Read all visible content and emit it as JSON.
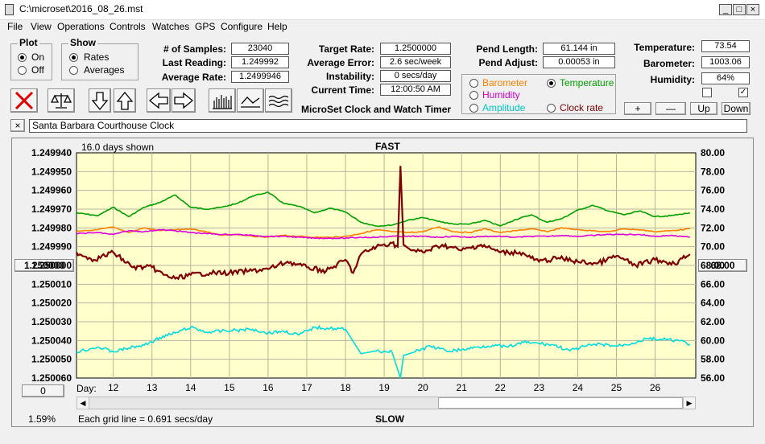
{
  "window": {
    "title": "C:\\microset\\2016_08_26.mst"
  },
  "window_controls": {
    "minimize": "_",
    "maximize": "□",
    "close": "×"
  },
  "menu": [
    "File",
    "View",
    "Operations",
    "Controls",
    "Watches",
    "GPS",
    "Configure",
    "Help"
  ],
  "plot_group": {
    "title": "Plot",
    "on_label": "On",
    "off_label": "Off",
    "selected": "On"
  },
  "show_group": {
    "title": "Show",
    "rates_label": "Rates",
    "averages_label": "Averages",
    "selected": "Rates"
  },
  "stats": {
    "samples_label": "# of Samples:",
    "samples_value": "23040",
    "last_reading_label": "Last Reading:",
    "last_reading_value": "1.249992",
    "average_rate_label": "Average Rate:",
    "average_rate_value": "1.2499946",
    "target_rate_label": "Target Rate:",
    "target_rate_value": "1.2500000",
    "average_error_label": "Average Error:",
    "average_error_value": "2.6 sec/week",
    "instability_label": "Instability:",
    "instability_value": "0 secs/day",
    "current_time_label": "Current Time:",
    "current_time_value": "12:00:50 AM",
    "pend_length_label": "Pend Length:",
    "pend_length_value": "61.144 in",
    "pend_adjust_label": "Pend Adjust:",
    "pend_adjust_value": "0.00053 in",
    "temperature_label": "Temperature:",
    "temperature_value": "73.54",
    "barometer_label": "Barometer:",
    "barometer_value": "1003.06",
    "humidity_label": "Humidity:",
    "humidity_value": "64%"
  },
  "app_caption": "MicroSet Clock and Watch Timer",
  "sensor_select": {
    "barometer": "Barometer",
    "temperature": "Temperature",
    "humidity": "Humidity",
    "amplitude": "Amplitude",
    "clock_rate": "Clock rate",
    "selected": "Temperature",
    "colors": {
      "barometer": "#ff8000",
      "temperature": "#00a000",
      "humidity": "#cc00cc",
      "amplitude": "#00c8c8",
      "clock_rate": "#800000"
    }
  },
  "adjust_buttons": {
    "plus": "+",
    "minus": "—",
    "up": "Up",
    "down": "Down"
  },
  "checkboxes": {
    "left": "",
    "right": "✓"
  },
  "clock_name": {
    "close": "×",
    "value": "Santa Barbara Courthouse Clock"
  },
  "chart_header": {
    "days_shown": "16.0 days shown",
    "top_label": "FAST",
    "bottom_label": "SLOW",
    "left_center_button": "1.250000",
    "right_center_button": "68.00",
    "scroll_button": "0",
    "day_prefix": "Day:",
    "percent": "1.59%",
    "grid_note": "Each grid line = 0.691 secs/day"
  },
  "chart_data": {
    "type": "line",
    "x_label": "Day:",
    "x_ticks": [
      "12",
      "13",
      "14",
      "15",
      "16",
      "17",
      "18",
      "19",
      "20",
      "21",
      "22",
      "23",
      "24",
      "25",
      "26"
    ],
    "y_left_ticks": [
      "1.249940",
      "1.249950",
      "1.249960",
      "1.249970",
      "1.249980",
      "1.249990",
      "1.250000",
      "1.250010",
      "1.250020",
      "1.250030",
      "1.250040",
      "1.250050",
      "1.250060"
    ],
    "y_right_ticks": [
      "80.00",
      "78.00",
      "76.00",
      "74.00",
      "72.00",
      "70.00",
      "68.00",
      "66.00",
      "64.00",
      "62.00",
      "60.00",
      "58.00",
      "56.00"
    ],
    "ylim_left": [
      1.25006,
      1.24994
    ],
    "ylim_right": [
      56.0,
      80.0
    ],
    "x_range": [
      11.05,
      27.05
    ],
    "grid": true,
    "series": [
      {
        "color": "#00a000",
        "axis": "right",
        "x": [
          11.05,
          11.6,
          12.0,
          12.4,
          12.8,
          13.2,
          13.6,
          14.0,
          14.4,
          14.8,
          15.2,
          15.6,
          16.0,
          16.4,
          16.8,
          17.2,
          17.6,
          18.0,
          18.4,
          18.8,
          19.2,
          19.6,
          20.0,
          20.4,
          20.8,
          21.2,
          21.6,
          22.0,
          22.4,
          22.8,
          23.2,
          23.6,
          24.0,
          24.4,
          24.8,
          25.2,
          25.6,
          26.0,
          26.4,
          26.9
        ],
        "y": [
          73.6,
          73.3,
          74.2,
          73.2,
          74.2,
          74.7,
          75.5,
          74.2,
          74.0,
          74.2,
          74.6,
          75.4,
          75.8,
          74.6,
          74.3,
          73.6,
          74.1,
          73.7,
          72.6,
          72.2,
          72.3,
          72.8,
          73.1,
          72.7,
          72.4,
          72.4,
          72.8,
          72.2,
          72.9,
          73.4,
          72.6,
          73.0,
          73.9,
          74.4,
          73.8,
          73.4,
          73.8,
          73.2,
          73.3,
          73.6
        ]
      },
      {
        "color": "#ff8000",
        "axis": "right",
        "x": [
          11.05,
          11.6,
          12.0,
          12.4,
          12.8,
          13.2,
          13.6,
          14.0,
          14.4,
          14.8,
          15.2,
          15.6,
          16.0,
          16.4,
          16.8,
          17.2,
          17.6,
          18.0,
          18.4,
          18.8,
          19.2,
          19.6,
          20.0,
          20.4,
          20.8,
          21.2,
          21.6,
          22.0,
          22.4,
          22.8,
          23.2,
          23.6,
          24.0,
          24.4,
          24.8,
          25.2,
          25.6,
          26.0,
          26.4,
          26.9
        ],
        "y": [
          71.6,
          71.8,
          72.1,
          71.5,
          72.0,
          71.7,
          71.8,
          71.9,
          71.6,
          71.2,
          71.3,
          71.1,
          71.0,
          71.2,
          71.1,
          71.0,
          71.0,
          71.1,
          71.4,
          71.8,
          71.6,
          71.5,
          71.6,
          72.1,
          71.6,
          71.5,
          71.9,
          71.5,
          71.7,
          71.9,
          71.6,
          72.0,
          71.8,
          71.7,
          71.6,
          71.9,
          71.8,
          71.6,
          71.7,
          71.9
        ]
      },
      {
        "color": "#dd00dd",
        "axis": "right",
        "x": [
          11.05,
          11.6,
          12.0,
          12.4,
          12.8,
          13.2,
          13.6,
          14.0,
          14.4,
          14.8,
          15.2,
          15.6,
          16.0,
          16.4,
          16.8,
          17.2,
          17.6,
          18.0,
          18.4,
          18.8,
          19.2,
          19.6,
          20.0,
          20.4,
          20.8,
          21.2,
          21.6,
          22.0,
          22.4,
          22.8,
          23.2,
          23.6,
          24.0,
          24.4,
          24.8,
          25.2,
          25.6,
          26.0,
          26.4,
          26.9
        ],
        "y": [
          71.4,
          71.5,
          71.3,
          71.7,
          71.6,
          71.8,
          71.7,
          71.5,
          71.4,
          71.3,
          71.3,
          71.2,
          71.1,
          71.1,
          71.0,
          70.9,
          70.9,
          70.9,
          71.0,
          71.0,
          71.1,
          71.1,
          71.1,
          71.0,
          71.1,
          71.0,
          71.1,
          71.1,
          71.0,
          71.1,
          71.1,
          71.2,
          71.1,
          71.2,
          71.3,
          71.3,
          71.3,
          71.1,
          71.2,
          71.0
        ]
      },
      {
        "color": "#800000",
        "axis": "left",
        "x": [
          11.05,
          11.5,
          12.0,
          12.5,
          13.0,
          13.3,
          13.6,
          14.0,
          14.5,
          15.0,
          15.5,
          16.0,
          16.5,
          17.0,
          17.5,
          18.0,
          18.2,
          18.4,
          18.8,
          19.2,
          19.35,
          19.42,
          19.5,
          19.7,
          20.0,
          20.5,
          21.0,
          21.5,
          22.0,
          22.5,
          23.0,
          23.5,
          24.0,
          24.5,
          25.0,
          25.5,
          26.0,
          26.5,
          26.9
        ],
        "y": [
          1.249993,
          1.249997,
          1.249993,
          1.250001,
          1.250001,
          1.250005,
          1.250007,
          1.250005,
          1.250004,
          1.250004,
          1.250003,
          1.250002,
          1.249998,
          1.250001,
          1.250003,
          1.249997,
          1.250004,
          1.249994,
          1.24999,
          1.249988,
          1.24999,
          1.249947,
          1.249989,
          1.249992,
          1.249993,
          1.249989,
          1.249992,
          1.249989,
          1.249993,
          1.249993,
          1.249998,
          1.249996,
          1.249998,
          1.249999,
          1.249995,
          1.25,
          1.249997,
          1.249999,
          1.249994
        ]
      },
      {
        "color": "#00dddd",
        "axis": "right",
        "x": [
          11.05,
          11.6,
          12.0,
          12.4,
          12.8,
          13.2,
          13.6,
          14.0,
          14.4,
          14.8,
          15.2,
          15.6,
          16.0,
          16.4,
          16.8,
          17.2,
          17.6,
          18.0,
          18.4,
          18.8,
          19.2,
          19.42,
          19.5,
          19.8,
          20.2,
          20.6,
          21.0,
          21.4,
          21.8,
          22.2,
          22.6,
          23.0,
          23.4,
          23.8,
          24.2,
          24.6,
          25.0,
          25.4,
          25.8,
          26.2,
          26.6,
          26.9
        ],
        "y": [
          58.8,
          59.3,
          58.8,
          59.2,
          59.5,
          60.3,
          60.8,
          61.4,
          60.9,
          61.0,
          61.1,
          61.2,
          60.8,
          61.0,
          60.6,
          61.4,
          61.3,
          61.2,
          58.6,
          58.9,
          58.8,
          56.0,
          58.4,
          58.8,
          59.4,
          58.9,
          59.0,
          59.3,
          59.5,
          59.3,
          59.8,
          59.7,
          59.5,
          58.9,
          59.4,
          59.6,
          59.4,
          59.7,
          60.2,
          60.1,
          60.0,
          59.6
        ]
      }
    ]
  }
}
